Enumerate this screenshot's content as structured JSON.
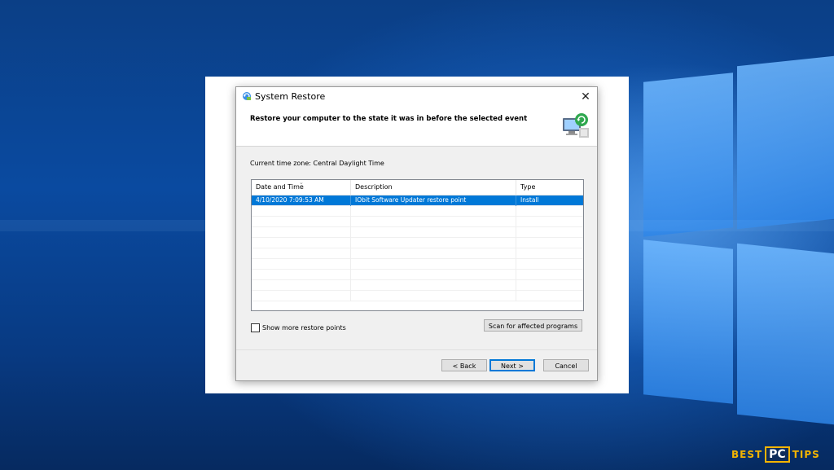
{
  "dialog": {
    "title": "System Restore",
    "header_text": "Restore your computer to the state it was in before the selected event",
    "timezone_text": "Current time zone: Central Daylight Time",
    "table": {
      "columns": [
        "Date and Time",
        "Description",
        "Type"
      ],
      "rows": [
        {
          "date_time": "4/10/2020 7:09:53 AM",
          "description": "IObit Software Updater restore point",
          "type": "Install",
          "selected": true
        }
      ]
    },
    "show_more_label": "Show more restore points",
    "scan_button": "Scan for affected programs",
    "back_button": "< Back",
    "next_button": "Next >",
    "cancel_button": "Cancel",
    "close_glyph": "✕"
  },
  "watermark": {
    "best": "BEST",
    "pc": "PC",
    "tips": "TIPS"
  },
  "icons": [
    "system-restore-icon",
    "close-icon",
    "restore-computer-icon",
    "sort-arrow-icon"
  ],
  "colors": {
    "selection": "#0078d7",
    "accent_yellow": "#f4b400",
    "desktop_blue": "#0a4aa0"
  }
}
